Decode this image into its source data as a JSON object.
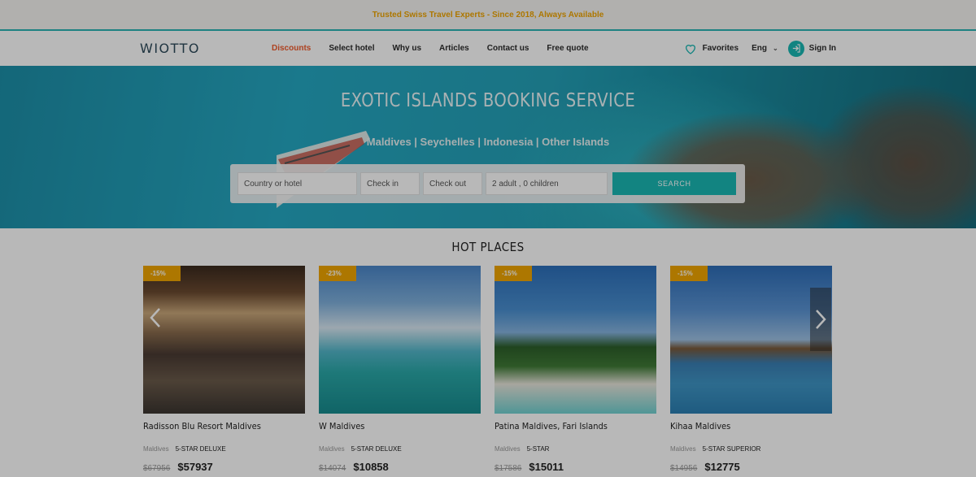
{
  "banner": {
    "text": "Trusted Swiss Travel Experts - Since 2018, Always Available"
  },
  "header": {
    "logo": "WIOTTO",
    "nav": [
      {
        "label": "Discounts",
        "active": true
      },
      {
        "label": "Select hotel"
      },
      {
        "label": "Why us"
      },
      {
        "label": "Articles"
      },
      {
        "label": "Contact us"
      },
      {
        "label": "Free quote"
      }
    ],
    "favorites": "Favorites",
    "language": "Eng",
    "signin": "Sign In"
  },
  "hero": {
    "title": "EXOTIC ISLANDS BOOKING SERVICE",
    "subtitle": "Maldives | Seychelles | Indonesia | Other Islands",
    "search": {
      "country_placeholder": "Country or hotel",
      "checkin": "Check in",
      "checkout": "Check out",
      "guests": "2 adult , 0 children",
      "button": "SEARCH"
    }
  },
  "hot_places": {
    "title": "HOT PLACES",
    "cards": [
      {
        "discount": "-15%",
        "name": "Radisson Blu Resort Maldives",
        "location": "Maldives",
        "stars": "5-STAR DELUXE",
        "old_price": "$67956",
        "price": "$57937"
      },
      {
        "discount": "-23%",
        "name": "W Maldives",
        "location": "Maldives",
        "stars": "5-STAR DELUXE",
        "old_price": "$14074",
        "price": "$10858"
      },
      {
        "discount": "-15%",
        "name": "Patina Maldives, Fari Islands",
        "location": "Maldives",
        "stars": "5-STAR",
        "old_price": "$17586",
        "price": "$15011"
      },
      {
        "discount": "-15%",
        "name": "Kihaa Maldives",
        "location": "Maldives",
        "stars": "5-STAR SUPERIOR",
        "old_price": "$14956",
        "price": "$12775"
      }
    ]
  },
  "colors": {
    "accent": "#19b7b3",
    "active_nav": "#f05a2b",
    "badge": "#f0a500"
  }
}
